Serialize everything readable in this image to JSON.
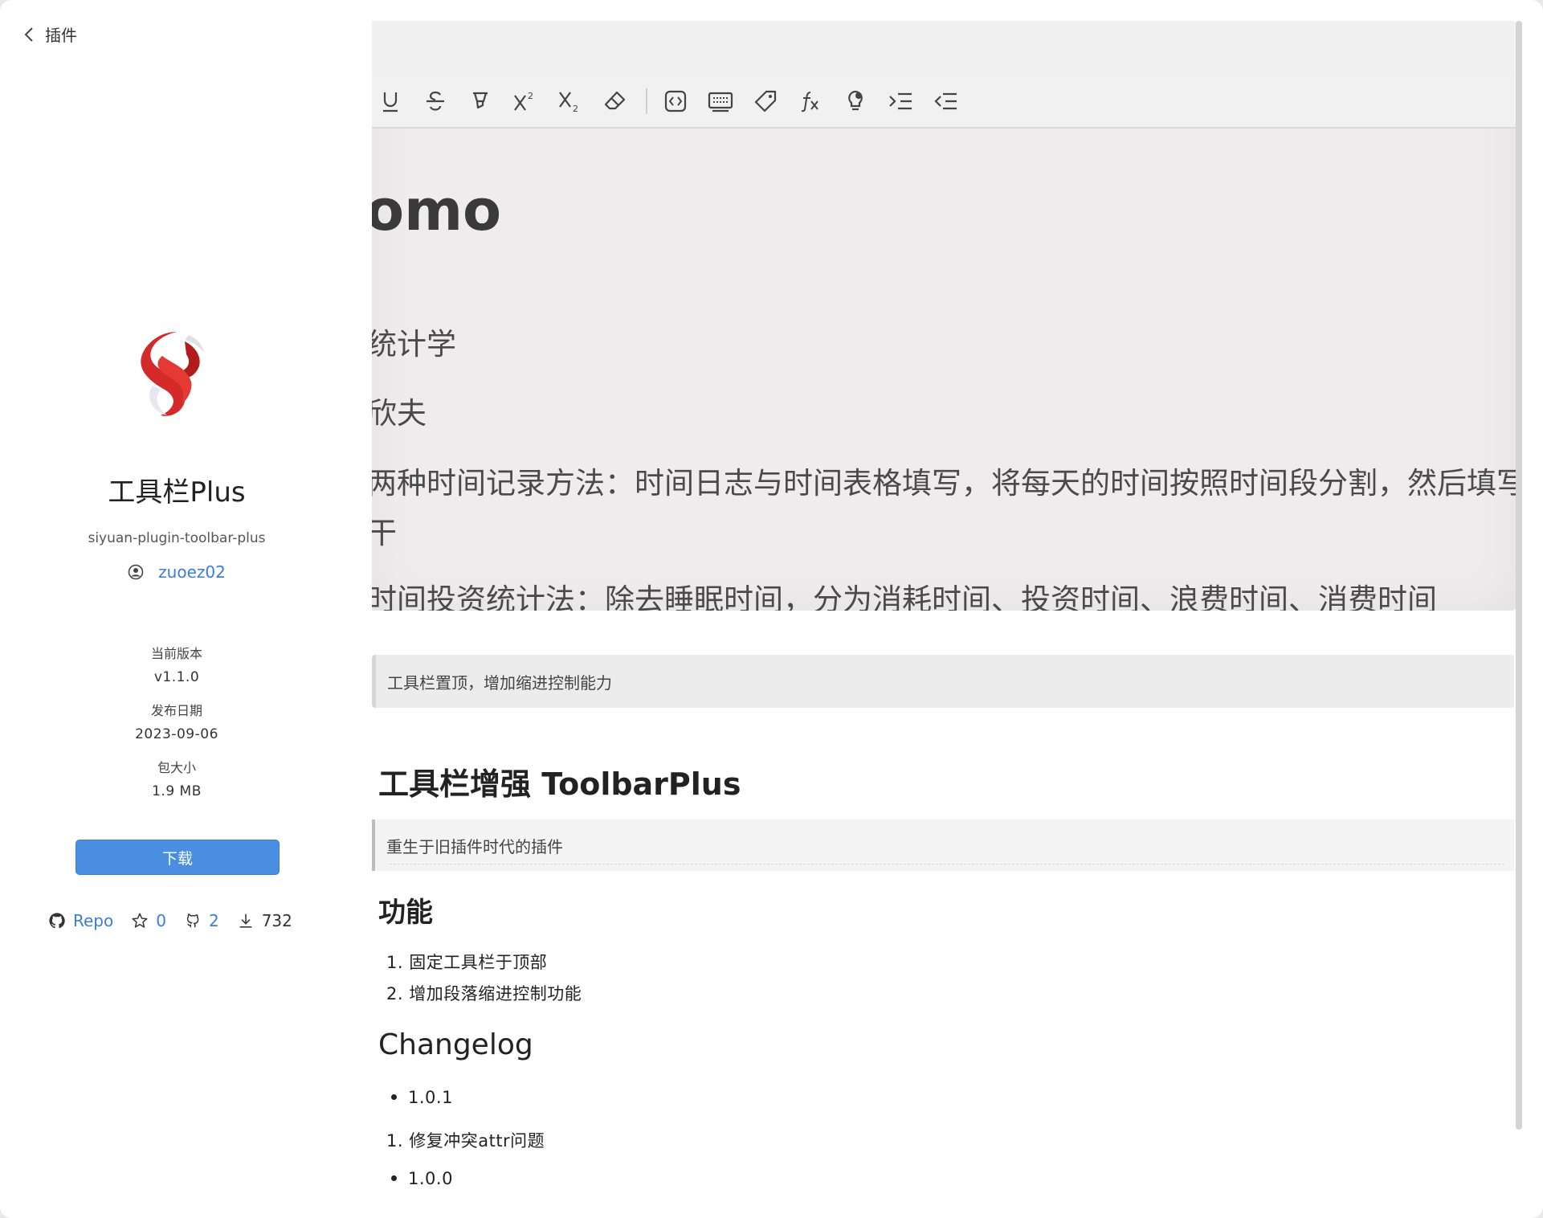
{
  "nav": {
    "back_label": "插件"
  },
  "plugin": {
    "name": "工具栏Plus",
    "id": "siyuan-plugin-toolbar-plus",
    "author": "zuoez02",
    "version_label": "当前版本",
    "version": "v1.1.0",
    "date_label": "发布日期",
    "date": "2023-09-06",
    "size_label": "包大小",
    "size": "1.9 MB",
    "download_label": "下载",
    "repo_label": "Repo",
    "stars": "0",
    "issues": "2",
    "downloads": "732"
  },
  "preview": {
    "title": "omo",
    "line1": "统计学",
    "line2": "欣夫",
    "line3": "两种时间记录方法：时间日志与时间表格填写，将每天的时间按照时间段分割，然后填写是",
    "line3b": "干",
    "line4": "时间投资统计法：除去睡眠时间，分为消耗时间、投资时间、浪费时间、消费时间",
    "toolbar_icons": [
      "underline-icon",
      "strikethrough-icon",
      "mark-icon",
      "superscript-icon",
      "subscript-icon",
      "eraser-icon",
      "inline-code-icon",
      "keyboard-icon",
      "tag-icon",
      "formula-icon",
      "inline-memo-icon",
      "indent-icon",
      "outdent-icon"
    ]
  },
  "readme": {
    "description": "工具栏置顶，增加缩进控制能力",
    "title": "工具栏增强 ToolbarPlus",
    "quote": "重生于旧插件时代的插件",
    "features_heading": "功能",
    "features": [
      "1. 固定工具栏于顶部",
      "2. 增加段落缩进控制功能"
    ],
    "changelog_heading": "Changelog",
    "changelog_v1": "1.0.1",
    "changelog_item1": "1. 修复冲突attr问题",
    "changelog_v0": "1.0.0"
  },
  "colors": {
    "accent": "#4a8ee0",
    "link": "#3b7dd8",
    "logo_red": "#d42a2a"
  }
}
